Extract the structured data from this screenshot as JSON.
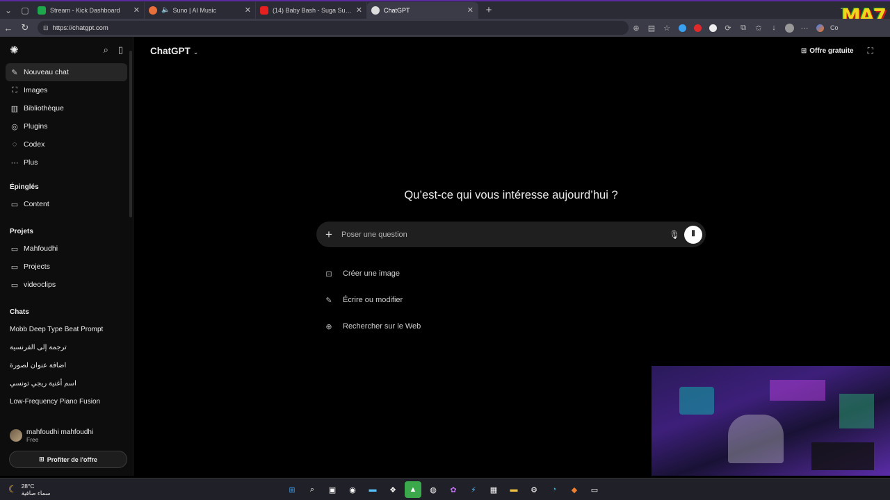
{
  "browser": {
    "tabs": [
      {
        "title": "Stream - Kick Dashboard",
        "favicon_color": "#1ea84b",
        "active": false
      },
      {
        "title": "Suno | AI Music",
        "favicon_color": "#e8703a",
        "active": false
      },
      {
        "title": "(14) Baby Bash - Suga Suga (Offici",
        "favicon_color": "#e62020",
        "active": false
      },
      {
        "title": "ChatGPT",
        "favicon_color": "#dddddd",
        "active": true
      }
    ],
    "url": "https://chatgpt.com",
    "copilot_label": "Co"
  },
  "sidebar": {
    "primary": [
      {
        "label": "Nouveau chat",
        "icon": "edit-icon"
      },
      {
        "label": "Images",
        "icon": "images-icon"
      },
      {
        "label": "Bibliothèque",
        "icon": "library-icon"
      },
      {
        "label": "Plugins",
        "icon": "plugins-icon"
      },
      {
        "label": "Codex",
        "icon": "codex-icon"
      },
      {
        "label": "Plus",
        "icon": "more-icon"
      }
    ],
    "pinned_title": "Épinglés",
    "pinned": [
      {
        "label": "Content"
      }
    ],
    "projects_title": "Projets",
    "projects": [
      {
        "label": "Mahfoudhi"
      },
      {
        "label": "Projects"
      },
      {
        "label": "videoclips"
      }
    ],
    "chats_title": "Chats",
    "chats": [
      {
        "label": "Mobb Deep Type Beat Prompt"
      },
      {
        "label": "ترجمة إلى الفرنسية"
      },
      {
        "label": "اضافة عنوان لصورة"
      },
      {
        "label": "اسم أغنية ريجي تونسي"
      },
      {
        "label": "Low-Frequency Piano Fusion"
      }
    ],
    "user": {
      "name": "mahfoudhi mahfoudhi",
      "plan": "Free"
    },
    "offer_button": "Profiter de l'offre"
  },
  "main": {
    "model_label": "ChatGPT",
    "offer_link": "Offre gratuite",
    "heading": "Qu’est-ce qui vous intéresse aujourd’hui ?",
    "composer": {
      "placeholder": "Poser une question"
    },
    "suggestions": [
      {
        "label": "Créer une image",
        "icon": "image-icon"
      },
      {
        "label": "Écrire ou modifier",
        "icon": "pencil-icon"
      },
      {
        "label": "Rechercher sur le Web",
        "icon": "globe-icon"
      }
    ]
  },
  "taskbar": {
    "temperature": "28°C",
    "weather_text": "سماء صافية"
  }
}
